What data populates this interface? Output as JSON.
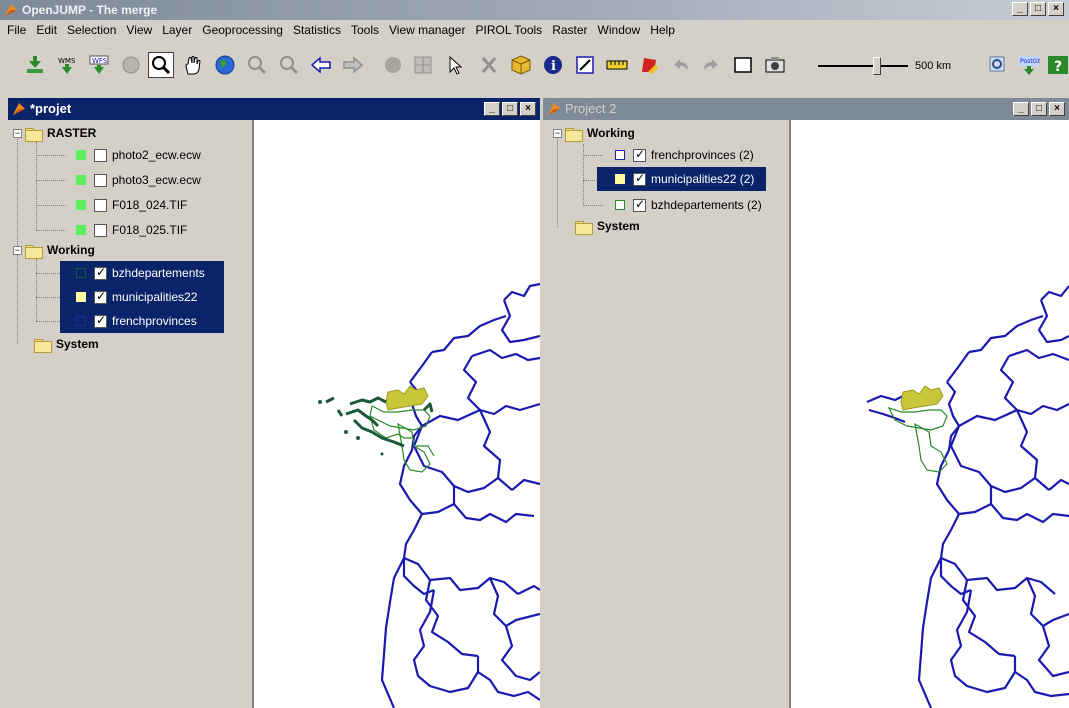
{
  "app": {
    "title": "OpenJUMP - The merge"
  },
  "menubar": [
    "File",
    "Edit",
    "Selection",
    "View",
    "Layer",
    "Geoprocessing",
    "Statistics",
    "Tools",
    "View manager",
    "PIROL Tools",
    "Raster",
    "Window",
    "Help"
  ],
  "toolbar": {
    "scale_label": "500 km",
    "buttons": [
      "load-dataset-icon",
      "wms-icon",
      "wfs-icon",
      "globe-disabled-icon",
      "zoom-icon",
      "pan-hand-icon",
      "globe-icon",
      "zoom-in-icon",
      "zoom-out-icon",
      "back-icon",
      "forward-icon",
      "zoom-layer-icon",
      "grid-icon",
      "select-arrow-icon",
      "delete-icon",
      "box-icon",
      "info-icon",
      "edit-icon",
      "measure-icon",
      "draw-icon",
      "undo-icon",
      "redo-icon",
      "rectangle-icon",
      "camera-icon",
      "zoom-extent-icon",
      "postgis-icon",
      "help-icon"
    ]
  },
  "colors": {
    "active_title": "#0a246a",
    "inactive_title": "#7f8a99",
    "selection": "#0a246a",
    "map_boundary": "#1a1ab0",
    "province_fill": "#c8c63a"
  },
  "frame1": {
    "title": "*projet",
    "tree": {
      "raster": {
        "label": "RASTER",
        "layers": [
          "photo2_ecw.ecw",
          "photo3_ecw.ecw",
          "F018_024.TIF",
          "F018_025.TIF"
        ]
      },
      "working": {
        "label": "Working",
        "layers": [
          "bzhdepartements",
          "municipalities22",
          "frenchprovinces"
        ]
      },
      "system": {
        "label": "System"
      }
    }
  },
  "frame2": {
    "title": "Project 2",
    "tree": {
      "working": {
        "label": "Working",
        "layers": [
          "frenchprovinces (2)",
          "municipalities22 (2)",
          "bzhdepartements (2)"
        ]
      },
      "system": {
        "label": "System"
      }
    }
  }
}
